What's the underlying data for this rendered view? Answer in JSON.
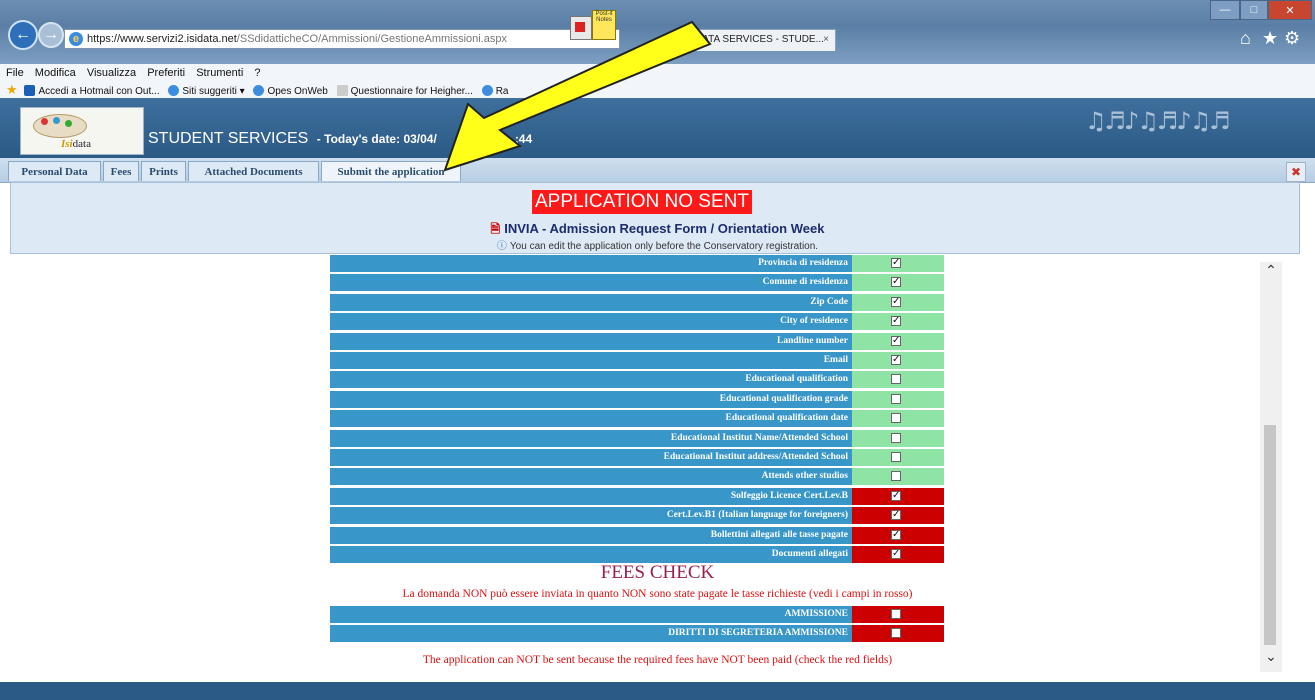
{
  "browser": {
    "url_host": "https://www.servizi2.",
    "url_domain": "isidata.net",
    "url_path": "/SSdidatticheCO/Ammissioni/GestioneAmmissioni.aspx",
    "tab_title": "DATA SERVICES - STUDE...",
    "tab_close": "×",
    "menu": [
      "File",
      "Modifica",
      "Visualizza",
      "Preferiti",
      "Strumenti",
      "?"
    ],
    "favorites": [
      "Accedi a Hotmail con Out...",
      "Siti suggeriti ▾",
      "Opes OnWeb",
      "Questionnaire for Heigher...",
      "Ra"
    ],
    "sticky_label": "Post-it Notes"
  },
  "site": {
    "logo_text_a": "Isi",
    "logo_text_b": "data",
    "title": "STUDENT SERVICES",
    "date_prefix": "- Today's date: 03/04/",
    "date_suffix": ":44"
  },
  "tabs": [
    "Personal Data",
    "Fees",
    "Prints",
    "Attached Documents",
    "Submit the application"
  ],
  "status": {
    "label": "APPLICATION NO SENT",
    "color": "#ff1a1a"
  },
  "form": {
    "title": "INVIA - Admission Request Form / Orientation Week",
    "note": "You can edit the application only before the Conservatory registration."
  },
  "checklist": [
    {
      "label": "Provincia di residenza",
      "ok": true,
      "checked": true
    },
    {
      "label": "Comune di residenza",
      "ok": true,
      "checked": true
    },
    {
      "label": "Zip Code",
      "ok": true,
      "checked": true
    },
    {
      "label": "City of residence",
      "ok": true,
      "checked": true
    },
    {
      "label": "Landline number",
      "ok": true,
      "checked": true
    },
    {
      "label": "Email",
      "ok": true,
      "checked": true
    },
    {
      "label": "Educational qualification",
      "ok": true,
      "checked": false
    },
    {
      "label": "Educational qualification grade",
      "ok": true,
      "checked": false
    },
    {
      "label": "Educational qualification date",
      "ok": true,
      "checked": false
    },
    {
      "label": "Educational Institut Name/Attended School",
      "ok": true,
      "checked": false
    },
    {
      "label": "Educational Institut address/Attended School",
      "ok": true,
      "checked": false
    },
    {
      "label": "Attends other studios",
      "ok": true,
      "checked": false
    },
    {
      "label": "Solfeggio Licence Cert.Lev.B",
      "ok": false,
      "checked": true
    },
    {
      "label": "Cert.Lev.B1 (Italian language for foreigners)",
      "ok": false,
      "checked": true
    },
    {
      "label": "Bollettini allegati alle tasse pagate",
      "ok": false,
      "checked": true
    },
    {
      "label": "Documenti allegati",
      "ok": false,
      "checked": true
    }
  ],
  "fees": {
    "title": "FEES CHECK",
    "warning_it": "La domanda NON può essere inviata in quanto NON sono state pagate le tasse richieste (vedi i campi in rosso)",
    "rows": [
      {
        "label": "AMMISSIONE",
        "ok": false,
        "checked": false
      },
      {
        "label": "DIRITTI DI SEGRETERIA AMMISSIONE",
        "ok": false,
        "checked": false
      }
    ],
    "warning_en": "The application can NOT be sent because the required fees have NOT been paid (check the red fields)"
  },
  "colors": {
    "row_label": "#3996c9",
    "cell_ok": "#8fe3a5",
    "cell_bad": "#cc0000",
    "arrow": "#ffff1a"
  }
}
